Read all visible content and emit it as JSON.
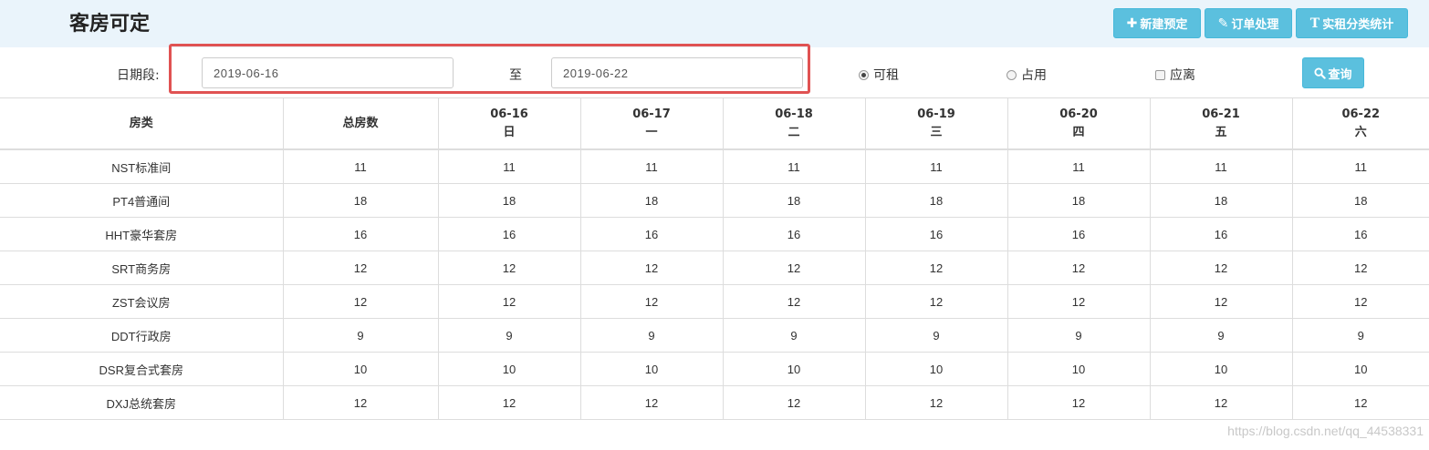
{
  "header": {
    "title": "客房可定",
    "buttons": {
      "new_booking": "新建预定",
      "order_processing": "订单处理",
      "rental_stats": "实租分类统计"
    }
  },
  "filter": {
    "date_range_label": "日期段:",
    "date_from": "2019-06-16",
    "to_label": "至",
    "date_to": "2019-06-22",
    "options": {
      "available": "可租",
      "occupied": "占用",
      "departure": "应离"
    },
    "selected_option": "available",
    "search_label": "查询"
  },
  "table": {
    "headers": {
      "room_type": "房类",
      "total_rooms": "总房数",
      "days": [
        {
          "date": "06-16",
          "weekday": "日"
        },
        {
          "date": "06-17",
          "weekday": "一"
        },
        {
          "date": "06-18",
          "weekday": "二"
        },
        {
          "date": "06-19",
          "weekday": "三"
        },
        {
          "date": "06-20",
          "weekday": "四"
        },
        {
          "date": "06-21",
          "weekday": "五"
        },
        {
          "date": "06-22",
          "weekday": "六"
        }
      ]
    },
    "rows": [
      {
        "room_type": "NST标准间",
        "total": "11",
        "days": [
          "11",
          "11",
          "11",
          "11",
          "11",
          "11",
          "11"
        ]
      },
      {
        "room_type": "PT4普通间",
        "total": "18",
        "days": [
          "18",
          "18",
          "18",
          "18",
          "18",
          "18",
          "18"
        ]
      },
      {
        "room_type": "HHT豪华套房",
        "total": "16",
        "days": [
          "16",
          "16",
          "16",
          "16",
          "16",
          "16",
          "16"
        ]
      },
      {
        "room_type": "SRT商务房",
        "total": "12",
        "days": [
          "12",
          "12",
          "12",
          "12",
          "12",
          "12",
          "12"
        ]
      },
      {
        "room_type": "ZST会议房",
        "total": "12",
        "days": [
          "12",
          "12",
          "12",
          "12",
          "12",
          "12",
          "12"
        ]
      },
      {
        "room_type": "DDT行政房",
        "total": "9",
        "days": [
          "9",
          "9",
          "9",
          "9",
          "9",
          "9",
          "9"
        ]
      },
      {
        "room_type": "DSR复合式套房",
        "total": "10",
        "days": [
          "10",
          "10",
          "10",
          "10",
          "10",
          "10",
          "10"
        ]
      },
      {
        "room_type": "DXJ总统套房",
        "total": "12",
        "days": [
          "12",
          "12",
          "12",
          "12",
          "12",
          "12",
          "12"
        ]
      }
    ]
  },
  "watermark": "https://blog.csdn.net/qq_44538331",
  "colors": {
    "accent": "#5bc0de",
    "header_bg": "#eaf4fb",
    "highlight": "#e05252"
  },
  "icons": {
    "new_booking": "plus-icon",
    "order_processing": "pencil-icon",
    "rental_stats": "text-icon",
    "search": "search-icon"
  }
}
